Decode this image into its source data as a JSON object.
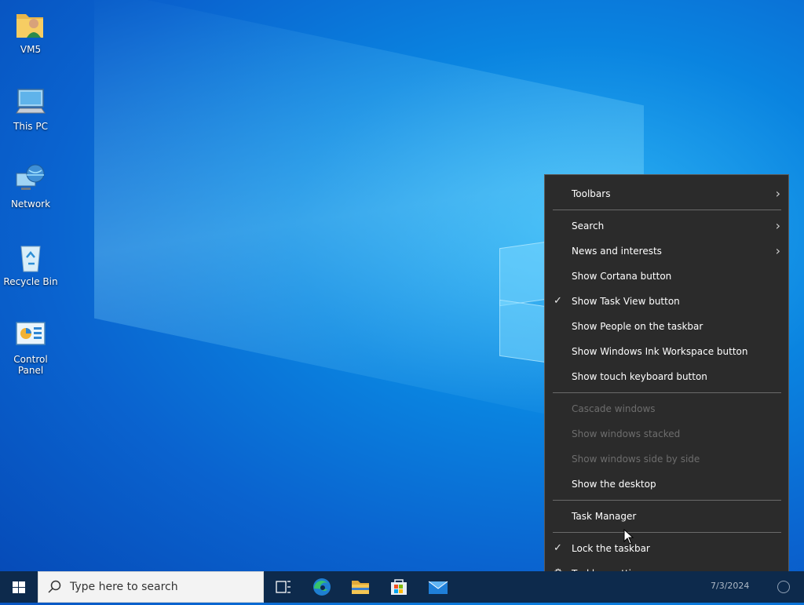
{
  "desktop": {
    "icons": [
      {
        "label": "VM5",
        "icon": "user-folder-icon"
      },
      {
        "label": "This PC",
        "icon": "computer-icon"
      },
      {
        "label": "Network",
        "icon": "network-icon"
      },
      {
        "label": "Recycle Bin",
        "icon": "recycle-bin-icon"
      },
      {
        "label": "Control Panel",
        "icon": "control-panel-icon"
      }
    ]
  },
  "context_menu": {
    "items": [
      {
        "label": "Toolbars",
        "submenu": true
      },
      {
        "label": "Search",
        "submenu": true
      },
      {
        "label": "News and interests",
        "submenu": true
      },
      {
        "label": "Show Cortana button"
      },
      {
        "label": "Show Task View button",
        "checked": true
      },
      {
        "label": "Show People on the taskbar"
      },
      {
        "label": "Show Windows Ink Workspace button"
      },
      {
        "label": "Show touch keyboard button"
      },
      {
        "label": "Cascade windows",
        "disabled": true
      },
      {
        "label": "Show windows stacked",
        "disabled": true
      },
      {
        "label": "Show windows side by side",
        "disabled": true
      },
      {
        "label": "Show the desktop"
      },
      {
        "label": "Task Manager"
      },
      {
        "label": "Lock the taskbar",
        "checked": true
      },
      {
        "label": "Taskbar settings",
        "icon": "gear-icon"
      }
    ]
  },
  "taskbar": {
    "search_placeholder": "Type here to search",
    "pinned": [
      "task-view-icon",
      "edge-icon",
      "file-explorer-icon",
      "store-icon",
      "mail-icon"
    ],
    "clock_date": "7/3/2024"
  },
  "colors": {
    "desktop_accent": "#0a84e0",
    "menu_bg": "#2b2b2b",
    "taskbar_bg": "#0d2a4c"
  }
}
